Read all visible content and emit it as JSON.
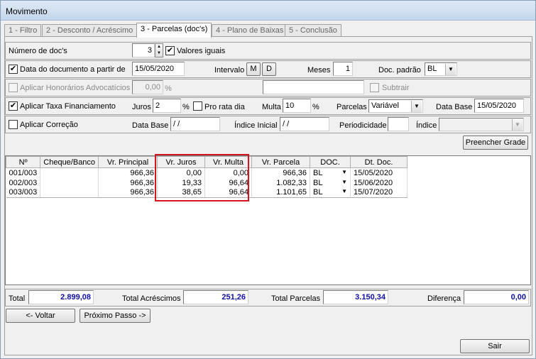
{
  "window": {
    "title": "Movimento"
  },
  "tabs": [
    {
      "label": "1 - Filtro"
    },
    {
      "label": "2 - Desconto / Acréscimo"
    },
    {
      "label": "3 - Parcelas (doc's)"
    },
    {
      "label": "4 - Plano de Baixas"
    },
    {
      "label": "5 - Conclusão"
    }
  ],
  "row1": {
    "num_docs_label": "Número de doc's",
    "num_docs_value": "3",
    "valores_iguais_label": "Valores iguais",
    "valores_iguais_checked": true
  },
  "row2": {
    "data_doc_label": "Data do documento a partir de",
    "data_doc_value": "15/05/2020",
    "intervalo_label": "Intervalo",
    "intervalo_m": "M",
    "intervalo_d": "D",
    "meses_label": "Meses",
    "meses_value": "1",
    "doc_padrao_label": "Doc. padrão",
    "doc_padrao_value": "BL"
  },
  "row3": {
    "honorarios_label": "Aplicar Honorários Advocatícios",
    "honorarios_value": "0,00",
    "percent": "%",
    "subtrair_label": "Subtrair"
  },
  "row4": {
    "taxa_label": "Aplicar Taxa Financiamento",
    "juros_label": "Juros",
    "juros_value": "2",
    "percent": "%",
    "pro_rata_label": "Pro rata dia",
    "multa_label": "Multa",
    "multa_value": "10",
    "parcelas_label": "Parcelas",
    "parcelas_value": "Variável",
    "data_base_label": "Data Base",
    "data_base_value": "15/05/2020"
  },
  "row5": {
    "correcao_label": "Aplicar Correção",
    "data_base_label": "Data Base",
    "data_base_value": " / /",
    "indice_inicial_label": "Índice Inicial",
    "indice_inicial_value": " / /",
    "periodicidade_label": "Periodicidade",
    "indice_label": "Índice"
  },
  "preencher_label": "Preencher Grade",
  "grid": {
    "headers": [
      "Nº",
      "Cheque/Banco",
      "Vr. Principal",
      "Vr. Juros",
      "Vr. Multa",
      "Vr. Parcela",
      "DOC.",
      "Dt. Doc."
    ],
    "rows": [
      {
        "n": "001/003",
        "cheque": "",
        "principal": "966,36",
        "juros": "0,00",
        "multa": "0,00",
        "parcela": "966,36",
        "doc": "BL",
        "dt": "15/05/2020"
      },
      {
        "n": "002/003",
        "cheque": "",
        "principal": "966,36",
        "juros": "19,33",
        "multa": "96,64",
        "parcela": "1.082,33",
        "doc": "BL",
        "dt": "15/06/2020"
      },
      {
        "n": "003/003",
        "cheque": "",
        "principal": "966,36",
        "juros": "38,65",
        "multa": "96,64",
        "parcela": "1.101,65",
        "doc": "BL",
        "dt": "15/07/2020"
      }
    ]
  },
  "totals": {
    "total_label": "Total",
    "total_value": "2.899,08",
    "acrescimos_label": "Total Acréscimos",
    "acrescimos_value": "251,26",
    "parcelas_label": "Total Parcelas",
    "parcelas_value": "3.150,34",
    "diferenca_label": "Diferença",
    "diferenca_value": "0,00"
  },
  "nav": {
    "voltar": "<- Voltar",
    "proximo": "Próximo Passo ->",
    "sair": "Sair"
  },
  "colors": {
    "highlight": "#d4141e",
    "total_text": "#1010a0"
  }
}
